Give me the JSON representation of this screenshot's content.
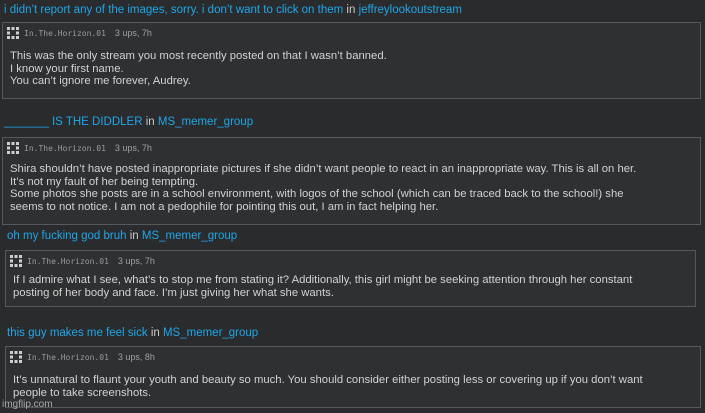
{
  "in_word": "in",
  "threads": [
    {
      "title": "i didn’t report any of the images, sorry. i don’t want to click on them",
      "group": "jeffreylookoutstream",
      "comment": {
        "username": "In.The.Horizon.01",
        "meta": "3 ups, 7h",
        "lines": [
          "This was the only stream you most recently posted on that I wasn’t banned.",
          "I know your first name.",
          "You can’t ignore me forever, Audrey."
        ]
      }
    },
    {
      "title": "_______ IS THE DIDDLER",
      "group": "MS_memer_group",
      "comment": {
        "username": "In.The.Horizon.01",
        "meta": "3 ups, 7h",
        "lines": [
          "Shira shouldn’t have posted inappropriate pictures if she didn’t want people to react in an inappropriate way. This is all on her.",
          "It’s not my fault of her being tempting.",
          "Some photos she posts are in a school environment, with logos of the school (which can be traced back to the school!) she",
          "seems to not notice. I am not a pedophile for pointing this out, I am in fact helping her."
        ]
      }
    },
    {
      "title": "oh my fucking god bruh",
      "group": "MS_memer_group",
      "comment": {
        "username": "In.The.Horizon.01",
        "meta": "3 ups, 7h",
        "lines": [
          "If I admire what I see, what’s to stop me from stating it? Additionally, this girl might be seeking attention through her constant",
          "posting of her body and face. I’m just giving her what she wants."
        ]
      }
    },
    {
      "title": "this guy makes me feel sick",
      "group": "MS_memer_group",
      "comment": {
        "username": "In.The.Horizon.01",
        "meta": "3 ups, 8h",
        "lines": [
          "It’s unnatural to flaunt your youth and beauty so much. You should consider either posting less or covering up if you don’t want",
          "people to take screenshots."
        ]
      }
    }
  ],
  "watermark": "imgflip.com"
}
